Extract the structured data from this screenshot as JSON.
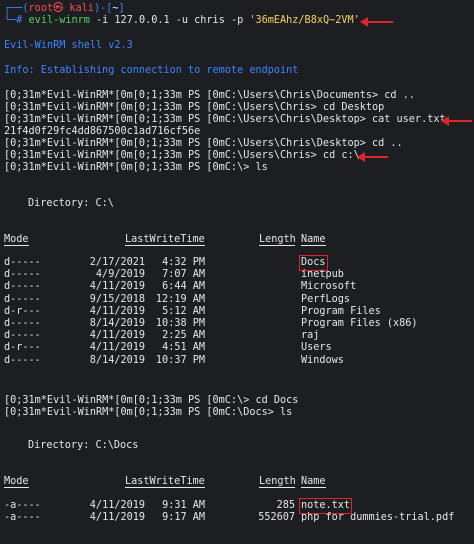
{
  "prompt_line": {
    "line1_prefix": "┌──(",
    "user_host": "root㉿ kali",
    "line1_mid": ")-[",
    "cwd": "~",
    "line1_suffix": "]",
    "line2_prefix": "└─# ",
    "command": "evil-winrm",
    "args": " -i 127.0.0.1 -u chris -p ",
    "password": "'36mEAhz/B8xQ~2VM'"
  },
  "banner": "Evil-WinRM shell v2.3",
  "info": "Info: Establishing connection to remote endpoint",
  "session": [
    "[0;31m*Evil-WinRM*[0m[0;1;33m PS [0mC:\\Users\\Chris\\Documents> cd ..",
    "[0;31m*Evil-WinRM*[0m[0;1;33m PS [0mC:\\Users\\Chris> cd Desktop",
    "[0;31m*Evil-WinRM*[0m[0;1;33m PS [0mC:\\Users\\Chris\\Desktop> cat user.txt",
    "21f4d0f29fc4dd867500c1ad716cf56e",
    "[0;31m*Evil-WinRM*[0m[0;1;33m PS [0mC:\\Users\\Chris\\Desktop> cd ..",
    "[0;31m*Evil-WinRM*[0m[0;1;33m PS [0mC:\\Users\\Chris> cd c:\\",
    "[0;31m*Evil-WinRM*[0m[0;1;33m PS [0mC:\\> ls"
  ],
  "dir1": {
    "title": "Directory: C:\\",
    "headers": {
      "mode": "Mode",
      "lwt": "LastWriteTime",
      "length": "Length",
      "name": "Name"
    },
    "rows": [
      {
        "mode": "d-----",
        "date": "2/17/2021",
        "time": "4:32 PM",
        "length": "",
        "name": "Docs"
      },
      {
        "mode": "d-----",
        "date": "4/9/2019",
        "time": "7:07 AM",
        "length": "",
        "name": "inetpub"
      },
      {
        "mode": "d-----",
        "date": "4/11/2019",
        "time": "6:44 AM",
        "length": "",
        "name": "Microsoft"
      },
      {
        "mode": "d-----",
        "date": "9/15/2018",
        "time": "12:19 AM",
        "length": "",
        "name": "PerfLogs"
      },
      {
        "mode": "d-r---",
        "date": "4/11/2019",
        "time": "5:12 AM",
        "length": "",
        "name": "Program Files"
      },
      {
        "mode": "d-----",
        "date": "8/14/2019",
        "time": "10:38 PM",
        "length": "",
        "name": "Program Files (x86)"
      },
      {
        "mode": "d-----",
        "date": "4/11/2019",
        "time": "2:25 AM",
        "length": "",
        "name": "raj"
      },
      {
        "mode": "d-r---",
        "date": "4/11/2019",
        "time": "4:51 AM",
        "length": "",
        "name": "Users"
      },
      {
        "mode": "d-----",
        "date": "8/14/2019",
        "time": "10:37 PM",
        "length": "",
        "name": "Windows"
      }
    ]
  },
  "session2": [
    "[0;31m*Evil-WinRM*[0m[0;1;33m PS [0mC:\\> cd Docs",
    "[0;31m*Evil-WinRM*[0m[0;1;33m PS [0mC:\\Docs> ls"
  ],
  "dir2": {
    "title": "Directory: C:\\Docs",
    "headers": {
      "mode": "Mode",
      "lwt": "LastWriteTime",
      "length": "Length",
      "name": "Name"
    },
    "rows": [
      {
        "mode": "-a----",
        "date": "4/11/2019",
        "time": "9:31 AM",
        "length": "285",
        "name": "note.txt"
      },
      {
        "mode": "-a----",
        "date": "4/11/2019",
        "time": "9:17 AM",
        "length": "552607",
        "name": "php for dummies-trial.pdf"
      }
    ]
  },
  "colors": {
    "background": "#1d1e21",
    "prompt_blue": "#3b86ff",
    "highlight_red": "#e0242b"
  }
}
